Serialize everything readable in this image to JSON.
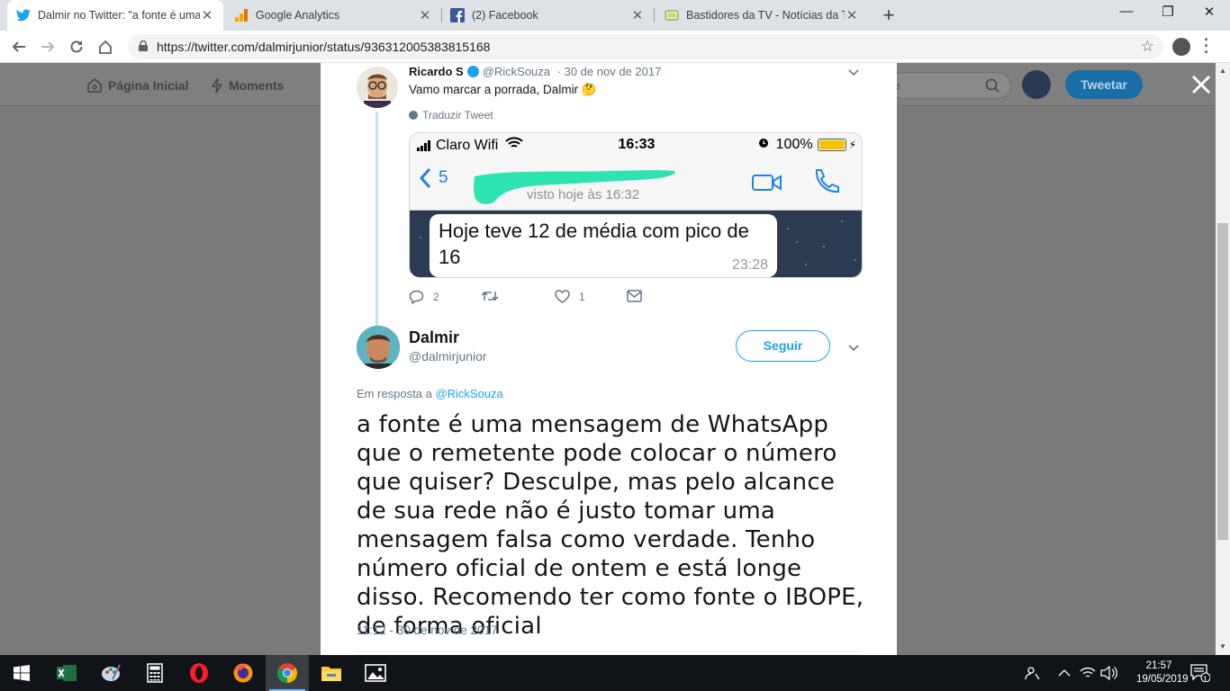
{
  "browser": {
    "tabs": [
      {
        "title": "Dalmir no Twitter: \"a fonte é uma",
        "icon": "twitter-icon",
        "active": true
      },
      {
        "title": "Google Analytics",
        "icon": "analytics-icon",
        "active": false
      },
      {
        "title": "(2) Facebook",
        "icon": "facebook-icon",
        "active": false
      },
      {
        "title": "Bastidores da TV - Notícias da TV",
        "icon": "bastidores-icon",
        "active": false
      }
    ],
    "url": "https://twitter.com/dalmirjunior/status/936312005383815168"
  },
  "twitter_header": {
    "home_label": "Página Inicial",
    "moments_label": "Moments",
    "search_fragment": "e",
    "tweet_button": "Tweetar"
  },
  "parent_tweet": {
    "name": "Ricardo S",
    "handle": "@RickSouza",
    "date": "· 30 de nov de 2017",
    "text": "Vamo marcar a porrada, Dalmir 🤔",
    "translate": "Traduzir Tweet",
    "replies": "2",
    "likes": "1",
    "media": {
      "carrier": "Claro Wifi",
      "time": "16:33",
      "battery": "100%",
      "back_count": "5",
      "seen": "visto hoje às 16:32",
      "message": "Hoje teve 12 de média com pico de 16",
      "message_time": "23:28"
    }
  },
  "main_tweet": {
    "name": "Dalmir",
    "handle": "@dalmirjunior",
    "follow_label": "Seguir",
    "reply_prefix": "Em resposta a",
    "reply_to": "@RickSouza",
    "text": "a fonte é uma mensagem de WhatsApp que o remetente pode colocar o número que quiser? Desculpe, mas pelo alcance de sua rede não é justo tomar uma mensagem falsa como verdade. Tenho número oficial de ontem e está longe disso. Recomendo ter como fonte o IBOPE, de forma oficial",
    "timestamp": "11:12 - 30 de nov de 2017"
  },
  "taskbar": {
    "apps": [
      "start-icon",
      "excel-icon",
      "paint-icon",
      "calculator-icon",
      "opera-icon",
      "firefox-icon",
      "chrome-icon",
      "file-explorer-icon",
      "photos-icon"
    ],
    "time": "21:57",
    "date": "19/05/2019",
    "notifications": "1"
  },
  "colors": {
    "twitter_blue": "#1da1f2",
    "muted_text": "#657786",
    "taskbar": "#101418"
  }
}
